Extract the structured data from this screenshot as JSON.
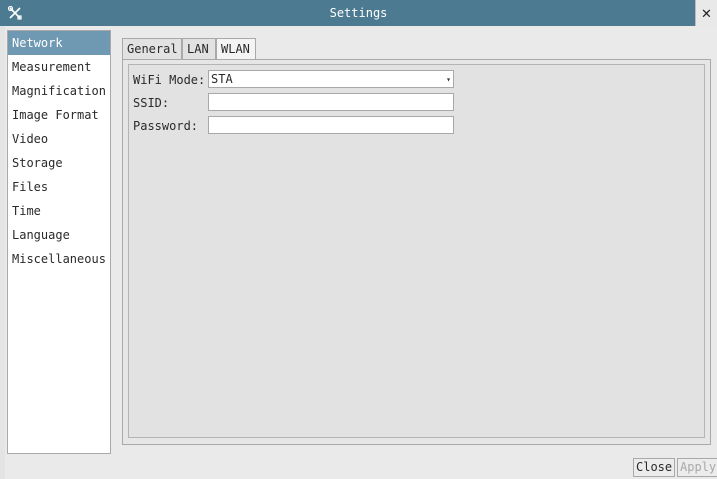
{
  "window": {
    "title": "Settings",
    "app_icon": "tools-icon",
    "close_glyph": "✕"
  },
  "sidebar": {
    "items": [
      {
        "label": "Network",
        "active": true
      },
      {
        "label": "Measurement",
        "active": false
      },
      {
        "label": "Magnification",
        "active": false
      },
      {
        "label": "Image Format",
        "active": false
      },
      {
        "label": "Video",
        "active": false
      },
      {
        "label": "Storage",
        "active": false
      },
      {
        "label": "Files",
        "active": false
      },
      {
        "label": "Time",
        "active": false
      },
      {
        "label": "Language",
        "active": false
      },
      {
        "label": "Miscellaneous",
        "active": false
      }
    ]
  },
  "tabs": [
    {
      "label": "General",
      "active": false
    },
    {
      "label": "LAN",
      "active": false
    },
    {
      "label": "WLAN",
      "active": true
    }
  ],
  "wlan": {
    "wifi_mode_label": "WiFi Mode:",
    "wifi_mode_value": "STA",
    "ssid_label": "SSID:",
    "ssid_value": "",
    "password_label": "Password:",
    "password_value": ""
  },
  "buttons": {
    "close_label": "Close",
    "apply_label": "Apply"
  },
  "colors": {
    "titlebar": "#4c7b91",
    "selection": "#6f98b3"
  }
}
